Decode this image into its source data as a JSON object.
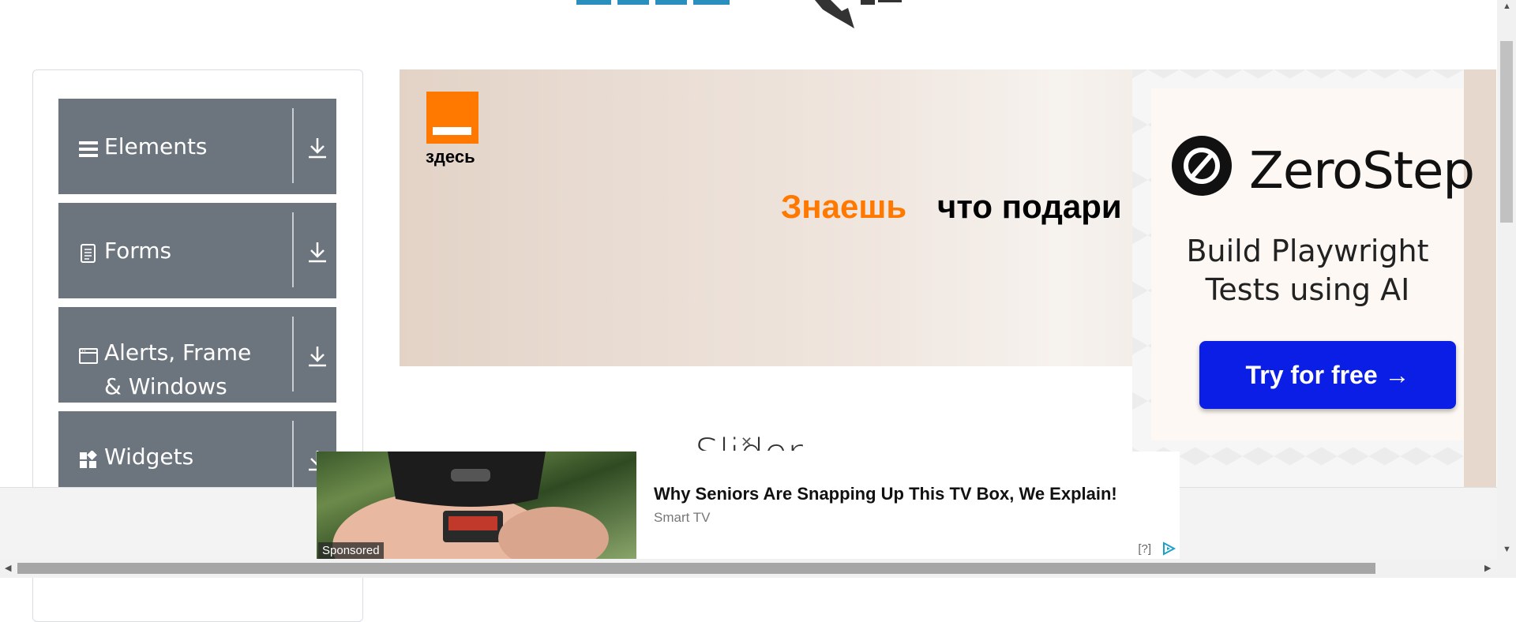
{
  "sidebar": {
    "groups": [
      {
        "label": "Elements",
        "icon": "hamburger-icon"
      },
      {
        "label": "Forms",
        "icon": "document-icon"
      },
      {
        "label": "Alerts, Frame & Windows",
        "icon": "window-icon"
      },
      {
        "label": "Widgets",
        "icon": "widgets-icon"
      }
    ]
  },
  "banner_ad": {
    "brand_word": "здесь",
    "headline_orange": "Знаешь",
    "headline_black": "что подари"
  },
  "zerostep_ad": {
    "brand": "ZeroStep",
    "tagline": "Build Playwright Tests using AI",
    "cta": "Try for free →"
  },
  "page": {
    "title": "Slider"
  },
  "sticky_ad": {
    "title": "Why Seniors Are Snapping Up This TV Box, We Explain!",
    "source": "Smart TV",
    "sponsored": "Sponsored",
    "info": "[?]"
  },
  "colors": {
    "sidebar_group_bg": "#6c757d",
    "orange_brand": "#ff7900",
    "cta_blue": "#0a1ee6"
  }
}
